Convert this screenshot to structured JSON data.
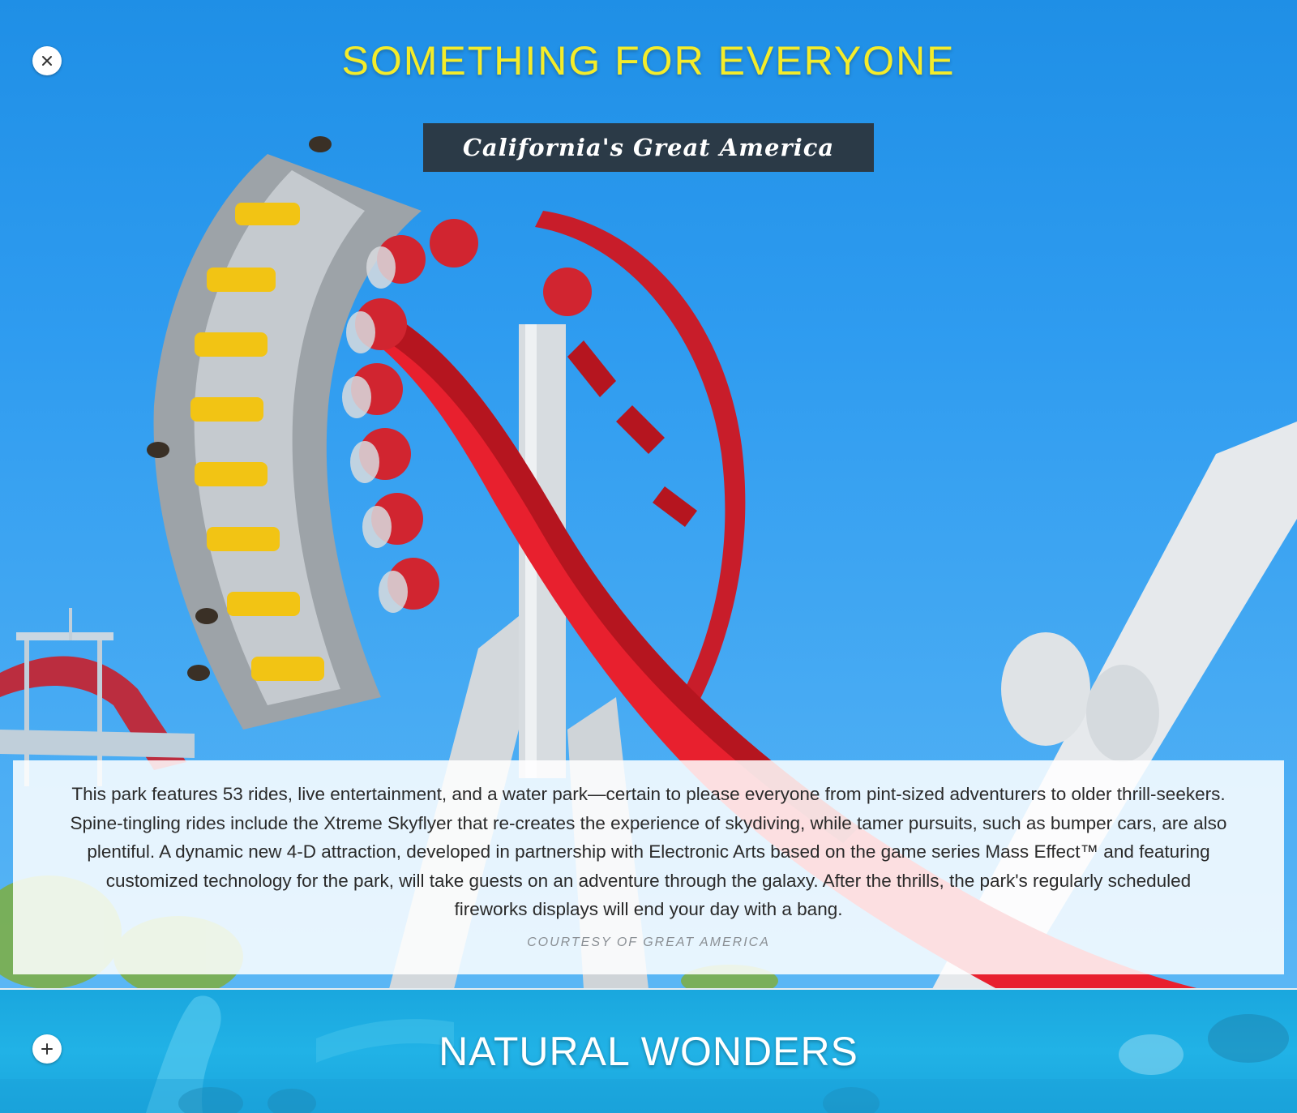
{
  "sections": {
    "active": {
      "title": "SOMETHING FOR EVERYONE",
      "close_icon": "close-icon",
      "title_color": "#f4ec2a",
      "location": "California's Great America",
      "description": "This park features 53 rides, live entertainment, and a water park—certain to please everyone from pint-sized adventurers to older thrill-seekers. Spine-tingling rides include the Xtreme Skyflyer that re-creates the experience of skydiving, while tamer pursuits, such as bumper cars, are also plentiful. A dynamic new 4-D attraction, developed in partnership with Electronic Arts based on the game series Mass Effect™ and featuring customized technology for the park, will take guests on an adventure through the galaxy. After the thrills, the park's regularly scheduled fireworks displays will end your day with a bang.",
      "credit": "COURTESY OF GREAT AMERICA"
    },
    "next": {
      "title": "NATURAL WONDERS",
      "expand_icon": "plus-icon"
    }
  },
  "colors": {
    "sky": "#2f9cf0",
    "coaster_track": "#e8202e",
    "tag_background": "#2b3a47",
    "lake": "#21b2e6"
  }
}
